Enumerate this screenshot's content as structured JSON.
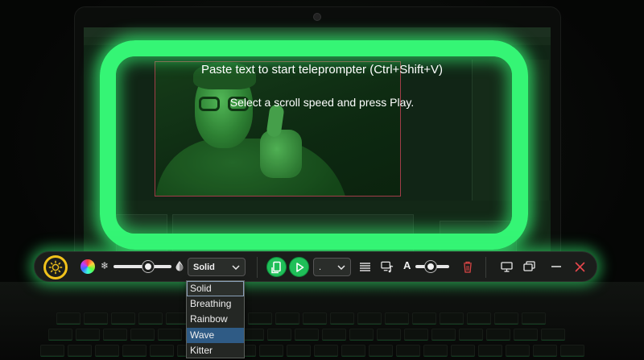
{
  "prompter": {
    "line1": "Paste text to start teleprompter (Ctrl+Shift+V)",
    "line2": "Select a scroll speed and press Play."
  },
  "controls": {
    "effect_select_value": "Solid",
    "speed_select_value": ".",
    "brightness_level": 0.6,
    "font_size_level": 0.45
  },
  "effect_menu": {
    "options": [
      "Solid",
      "Breathing",
      "Rainbow",
      "Wave",
      "Kitter"
    ],
    "selected": "Solid",
    "highlighted": "Wave"
  },
  "colors": {
    "accent_green": "#35f575",
    "play_green": "#1fbf58",
    "sun_yellow": "#f1c21b",
    "close_red": "#e8474d",
    "delete_red": "#d84545",
    "menu_highlight": "#2f5b85"
  },
  "icons": {
    "brightness": "sun-icon",
    "color": "color-wheel-icon",
    "dim": "snowflake-icon",
    "tint": "drop-icon",
    "page_fit": "page-icon",
    "play": "play-icon",
    "align": "align-justify-icon",
    "voice": "monitor-music-icon",
    "font_size": "font-size-icon",
    "delete": "trash-icon",
    "display": "monitor-icon",
    "windows": "windows-icon",
    "minimize": "minimize-icon",
    "close": "close-icon"
  }
}
